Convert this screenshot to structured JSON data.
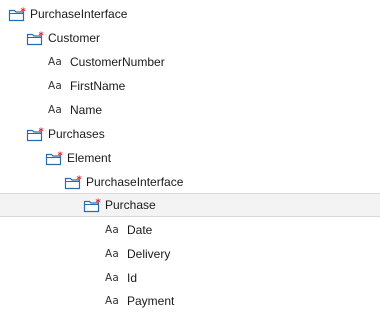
{
  "tree": {
    "nodes": [
      {
        "name": "tree-node-purchaseinterface-root",
        "kind": "folder",
        "label": "PurchaseInterface",
        "selected": false
      },
      {
        "name": "tree-node-customer",
        "kind": "folder",
        "label": "Customer",
        "selected": false
      },
      {
        "name": "tree-node-customernumber",
        "kind": "text",
        "label": "CustomerNumber",
        "selected": false
      },
      {
        "name": "tree-node-firstname",
        "kind": "text",
        "label": "FirstName",
        "selected": false
      },
      {
        "name": "tree-node-name",
        "kind": "text",
        "label": "Name",
        "selected": false
      },
      {
        "name": "tree-node-purchases",
        "kind": "folder",
        "label": "Purchases",
        "selected": false
      },
      {
        "name": "tree-node-element",
        "kind": "folder",
        "label": "Element",
        "selected": false
      },
      {
        "name": "tree-node-purchaseinterface-nested",
        "kind": "folder",
        "label": "PurchaseInterface",
        "selected": false
      },
      {
        "name": "tree-node-purchase",
        "kind": "folder",
        "label": "Purchase",
        "selected": true
      },
      {
        "name": "tree-node-date",
        "kind": "text",
        "label": "Date",
        "selected": false
      },
      {
        "name": "tree-node-delivery",
        "kind": "text",
        "label": "Delivery",
        "selected": false
      },
      {
        "name": "tree-node-id",
        "kind": "text",
        "label": "Id",
        "selected": false
      },
      {
        "name": "tree-node-payment",
        "kind": "text",
        "label": "Payment",
        "selected": false
      }
    ],
    "text_type_glyph": "Aa"
  },
  "icons": {
    "folder": "folder-asterisk-icon",
    "text": "text-type-icon"
  },
  "colors": {
    "folder_outline": "#2b6cb0",
    "folder_fill": "#ffffff",
    "asterisk": "#e01b24",
    "selection_background": "#f3f3f3",
    "selection_border": "#d9d9d9"
  }
}
